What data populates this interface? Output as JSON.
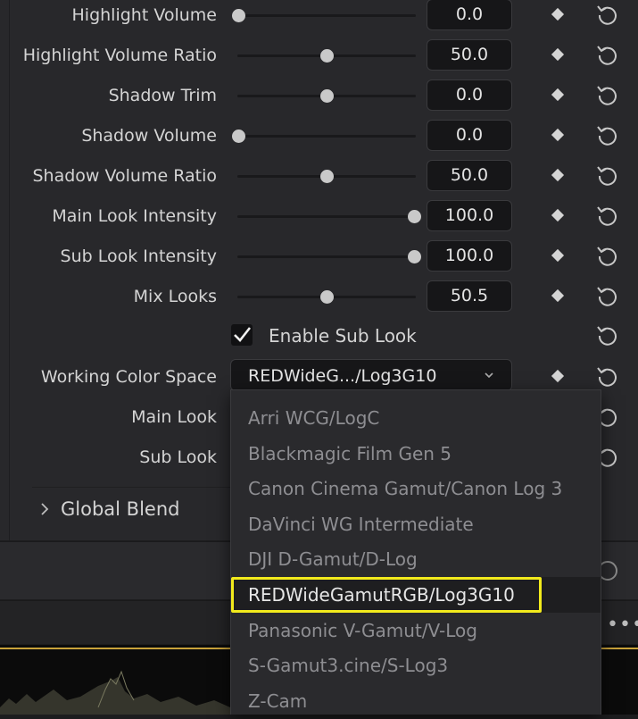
{
  "rows": [
    {
      "label": "Highlight Volume",
      "value": "0.0",
      "level": 0.0
    },
    {
      "label": "Highlight Volume Ratio",
      "value": "50.0",
      "level": 0.5
    },
    {
      "label": "Shadow Trim",
      "value": "0.0",
      "level": 0.5
    },
    {
      "label": "Shadow Volume",
      "value": "0.0",
      "level": 0.0
    },
    {
      "label": "Shadow Volume Ratio",
      "value": "50.0",
      "level": 0.5
    },
    {
      "label": "Main Look Intensity",
      "value": "100.0",
      "level": 1.0
    },
    {
      "label": "Sub Look Intensity",
      "value": "100.0",
      "level": 1.0
    },
    {
      "label": "Mix Looks",
      "value": "50.5",
      "level": 0.5
    }
  ],
  "enable_sub_look": {
    "label": "Enable Sub Look",
    "checked": true
  },
  "working_color_space": {
    "label": "Working Color Space",
    "value": "REDWideG.../Log3G10",
    "options": [
      "Arri WCG/LogC",
      "Blackmagic Film Gen 5",
      "Canon Cinema Gamut/Canon Log 3",
      "DaVinci WG Intermediate",
      "DJI D-Gamut/D-Log",
      "REDWideGamutRGB/Log3G10",
      "Panasonic V-Gamut/V-Log",
      "S-Gamut3.cine/S-Log3",
      "Z-Cam"
    ],
    "selected_index": 5
  },
  "main_look": {
    "label": "Main Look"
  },
  "sub_look": {
    "label": "Sub Look"
  },
  "global_blend": {
    "label": "Global Blend"
  },
  "icons": {
    "keyframe": "diamond-keyframe-icon",
    "reset": "reset-icon",
    "more": "more-dots-icon"
  },
  "colors": {
    "highlight": "#f2ea1c",
    "scope_line": "#c9a23a"
  }
}
